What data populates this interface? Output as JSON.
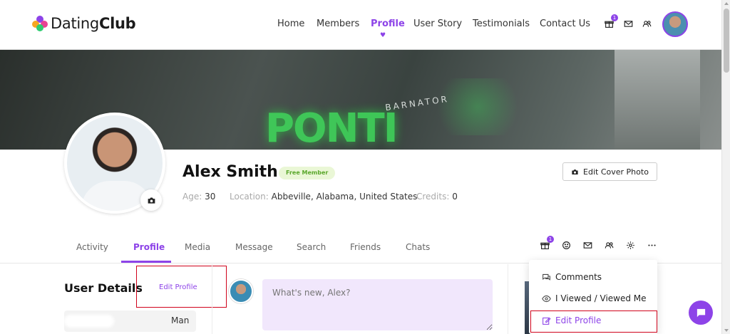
{
  "brand": {
    "name_light": "Dating",
    "name_bold": "Club",
    "colors": [
      "#8d43e8",
      "#f5a623",
      "#2ecc71",
      "#e84393"
    ]
  },
  "nav": {
    "items": [
      "Home",
      "Members",
      "Profile",
      "User Story",
      "Testimonials",
      "Contact Us"
    ],
    "active": "Profile",
    "gift_badge": "1",
    "icons": [
      "gift-icon",
      "mail-icon",
      "users-icon"
    ]
  },
  "cover": {
    "sign_text": "PONTI",
    "sign_sub": "BARNATOR"
  },
  "profile": {
    "name": "Alex Smith",
    "badge": "Free Member",
    "age_label": "Age:",
    "age": "30",
    "location_label": "Location:",
    "location": "Abbeville, Alabama, United States",
    "credits_label": "Credits:",
    "credits": "0",
    "edit_cover_label": "Edit Cover Photo"
  },
  "tabs": {
    "items": [
      "Activity",
      "Profile",
      "Media",
      "Message",
      "Search",
      "Friends",
      "Chats"
    ],
    "active": "Profile",
    "gift_badge": "1",
    "icons": [
      "gift-icon",
      "smile-icon",
      "mail-icon",
      "users-icon",
      "gear-icon",
      "more-icon"
    ]
  },
  "details": {
    "title": "User Details",
    "edit_link": "Edit Profile",
    "gender": "Man"
  },
  "post": {
    "placeholder": "What's new, Alex?"
  },
  "dropdown": {
    "items": [
      {
        "label": "Comments",
        "icon": "comments-icon"
      },
      {
        "label": "I Viewed / Viewed Me",
        "icon": "eye-icon"
      },
      {
        "label": "Edit Profile",
        "icon": "edit-icon"
      }
    ]
  },
  "accent": "#8d43e8",
  "highlight": "#d0021b"
}
